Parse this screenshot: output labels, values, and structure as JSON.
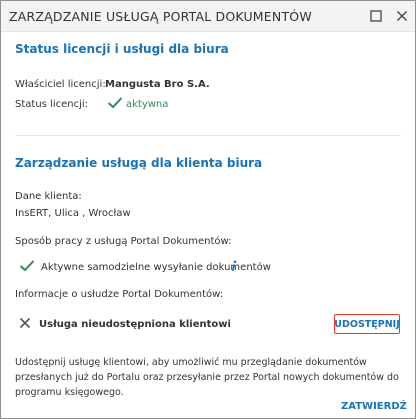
{
  "window": {
    "title": "ZARZĄDZANIE USŁUGĄ PORTAL DOKUMENTÓW"
  },
  "license_section": {
    "title": "Status licencji i usługi dla biura",
    "owner_label": "Właściciel licencji:",
    "owner_value": "Mangusta Bro S.A.",
    "status_label": "Status licencji:",
    "status_value": "aktywna"
  },
  "client_section": {
    "title": "Zarządzanie usługą dla klienta biura",
    "client_data_label": "Dane klienta:",
    "client_data_value": "InsERT, Ulica , Wrocław",
    "work_mode_label": "Sposób pracy z usługą Portal Dokumentów:",
    "work_mode_value": "Aktywne samodzielne wysyłanie dokumentów",
    "service_info_label": "Informacje o usłudze Portal Dokumentów:",
    "service_status": "Usługa nieudostępniona klientowi",
    "share_button": "UDOSTĘPNIJ",
    "description": "Udostępnij usługę klientowi, aby umożliwić mu przeglądanie dokumentów przesłanych już do Portalu oraz przesyłanie przez Portal nowych dokumentów do programu księgowego."
  },
  "footer": {
    "confirm_button": "ZATWIERDŹ"
  },
  "icons": {
    "maximize": "maximize-icon",
    "close": "close-icon",
    "active_status": "checkmark-icon",
    "work_mode": "checkmark-icon",
    "info": "info-icon",
    "not_shared": "x-mark-icon"
  },
  "colors": {
    "accent": "#1a73b8",
    "success": "#2e8b57",
    "highlight_border": "#e53935"
  }
}
